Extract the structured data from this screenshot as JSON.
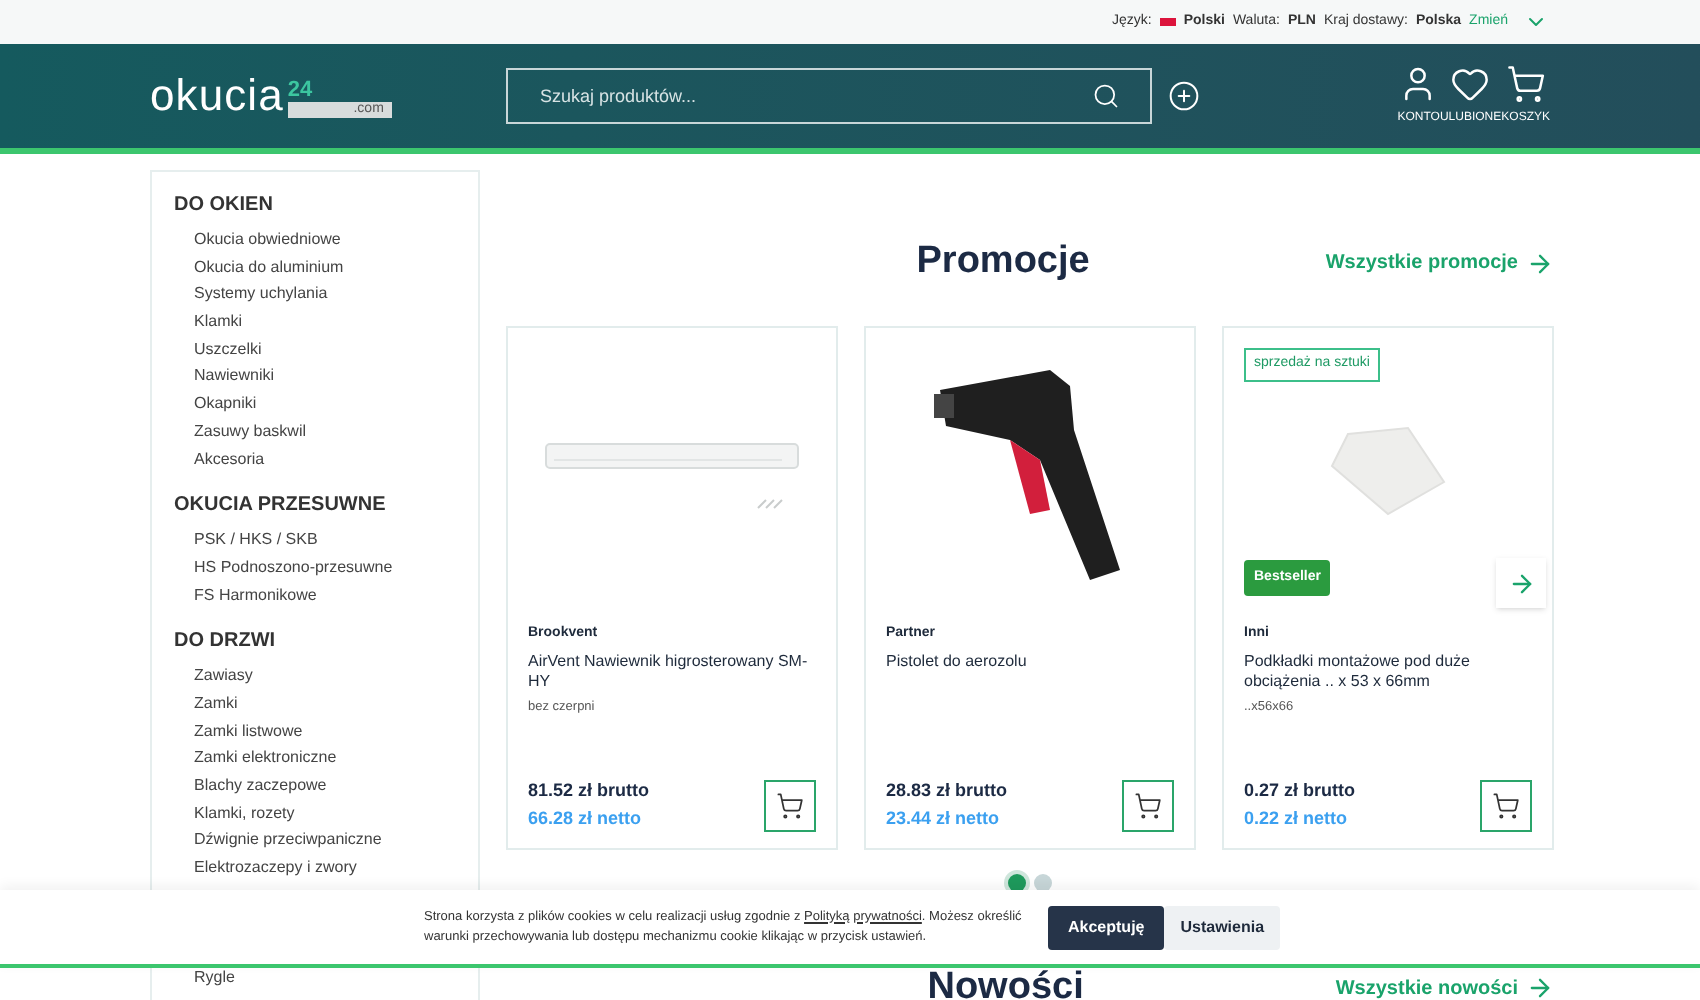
{
  "topbar": {
    "language_label": "Język:",
    "language": "Polski",
    "currency_label": "Waluta:",
    "currency": "PLN",
    "country_label": "Kraj dostawy:",
    "country": "Polska",
    "change": "Zmień"
  },
  "header": {
    "logo": "okucia",
    "logo_sup": "24",
    "logo_domain": ".com",
    "search": {
      "placeholder": "Szukaj produktów..."
    },
    "actions": [
      {
        "kind": "account",
        "label": "KONTO"
      },
      {
        "kind": "favorites",
        "label": "ULUBIONE"
      },
      {
        "kind": "cart",
        "label": "KOSZYK"
      }
    ]
  },
  "sidebar": [
    {
      "title": "DO OKIEN",
      "items": [
        "Okucia obwiedniowe",
        "Okucia do aluminium",
        "Systemy uchylania",
        "Klamki",
        "Uszczelki",
        "Nawiewniki",
        "Okapniki",
        "Zasuwy baskwil",
        "Akcesoria"
      ]
    },
    {
      "title": "OKUCIA PRZESUWNE",
      "items": [
        "PSK / HKS / SKB",
        "HS Podnoszono-przesuwne",
        "FS Harmonikowe"
      ]
    },
    {
      "title": "DO DRZWI",
      "items": [
        "Zawiasy",
        "Zamki",
        "Zamki listwowe",
        "Zamki elektroniczne",
        "Blachy zaczepowe",
        "Klamki, rozety",
        "Dźwignie przeciwpaniczne",
        "Elektrozaczepy i zwory",
        "Rygle"
      ]
    }
  ],
  "promotions": {
    "title": "Promocje",
    "link": "Wszystkie promocje",
    "products": [
      {
        "kind": "vent",
        "brand": "Brookvent",
        "name": "AirVent Nawiewnik higrosterowany SM-HY",
        "variant": "bez czerpni",
        "gross": "81.52 zł brutto",
        "net": "66.28 zł netto"
      },
      {
        "kind": "gun",
        "brand": "Partner",
        "name": "Pistolet do aerozolu",
        "gross": "28.83 zł brutto",
        "net": "23.44 zł netto"
      },
      {
        "kind": "plate",
        "tag": "sprzedaż na sztuki",
        "badge": "Bestseller",
        "brand": "Inni",
        "name": "Podkładki montażowe pod duże obciążenia .. x 53 x 66mm",
        "variant": "..x56x66",
        "gross": "0.27 zł brutto",
        "net": "0.22 zł netto"
      }
    ],
    "dots": [
      {
        "selected": true
      },
      {
        "selected": false
      }
    ]
  },
  "cookie": {
    "text_before": "Strona korzysta z plików cookies w celu realizacji usług zgodnie z ",
    "link": "Polityką prywatności",
    "text_after": ". Możesz określić warunki przechowywania lub dostępu mechanizmu cookie klikając w przycisk ustawień.",
    "accept": "Akceptuję",
    "settings": "Ustawienia"
  },
  "news": {
    "title": "Nowości",
    "link": "Wszystkie nowości"
  }
}
